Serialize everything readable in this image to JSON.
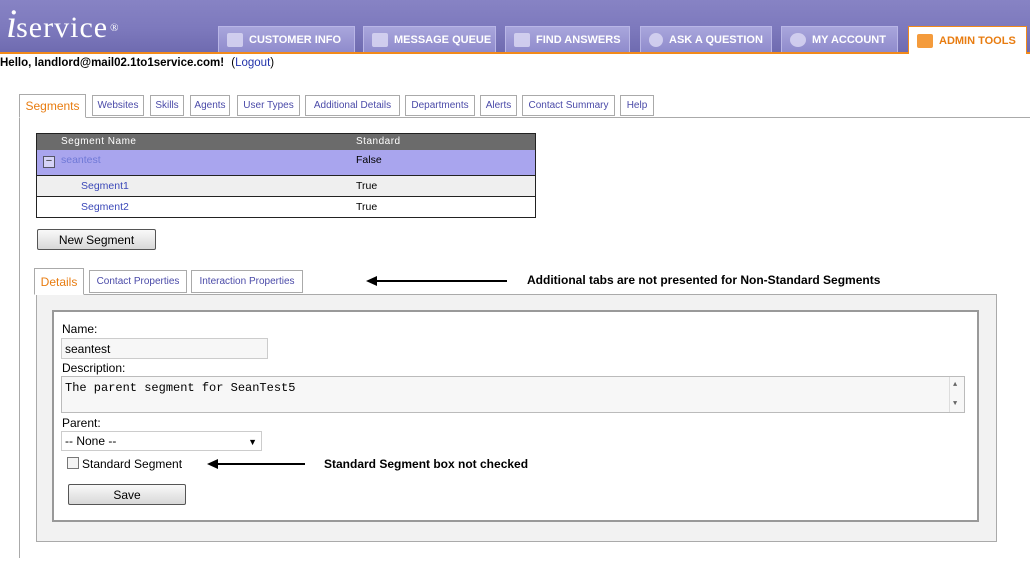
{
  "header": {
    "logo_text": "service",
    "logo_mark": "®",
    "nav": [
      {
        "label": "CUSTOMER INFO",
        "icon": "people-icon"
      },
      {
        "label": "MESSAGE QUEUE",
        "icon": "document-icon"
      },
      {
        "label": "FIND ANSWERS",
        "icon": "book-icon"
      },
      {
        "label": "ASK A QUESTION",
        "icon": "question-icon"
      },
      {
        "label": "MY ACCOUNT",
        "icon": "eye-icon"
      },
      {
        "label": "ADMIN TOOLS",
        "icon": "wrench-icon",
        "active": true
      }
    ]
  },
  "greeting": {
    "text": "Hello, landlord@mail02.1to1service.com!",
    "logout_open": "(",
    "logout": "Logout",
    "logout_close": ")"
  },
  "tabs": [
    {
      "label": "Segments",
      "active": true
    },
    {
      "label": "Websites"
    },
    {
      "label": "Skills"
    },
    {
      "label": "Agents"
    },
    {
      "label": "User Types"
    },
    {
      "label": "Additional Details"
    },
    {
      "label": "Departments"
    },
    {
      "label": "Alerts"
    },
    {
      "label": "Contact Summary"
    },
    {
      "label": "Help"
    }
  ],
  "grid": {
    "columns": [
      "Segment Name",
      "Standard"
    ],
    "rows": [
      {
        "name": "seantest",
        "standard": "False",
        "selected": true,
        "collapse": "−"
      },
      {
        "name": "Segment1",
        "standard": "True"
      },
      {
        "name": "Segment2",
        "standard": "True"
      }
    ]
  },
  "new_segment_button": "New Segment",
  "inner_tabs": [
    {
      "label": "Details",
      "active": true
    },
    {
      "label": "Contact Properties"
    },
    {
      "label": "Interaction Properties"
    }
  ],
  "form": {
    "name_label": "Name:",
    "name_value": "seantest",
    "description_label": "Description:",
    "description_value": "The parent segment for SeanTest5",
    "parent_label": "Parent:",
    "parent_value": "-- None --",
    "standard_label": "Standard Segment",
    "standard_checked": false,
    "save_label": "Save"
  },
  "annotations": {
    "tabs_note": "Additional tabs are not presented for Non-Standard Segments",
    "checkbox_note": "Standard Segment box not checked"
  },
  "colors": {
    "header": "#7d79bd",
    "accent": "#f28a1a",
    "selected_row": "#a9a5ee",
    "link": "#3b48b8"
  }
}
